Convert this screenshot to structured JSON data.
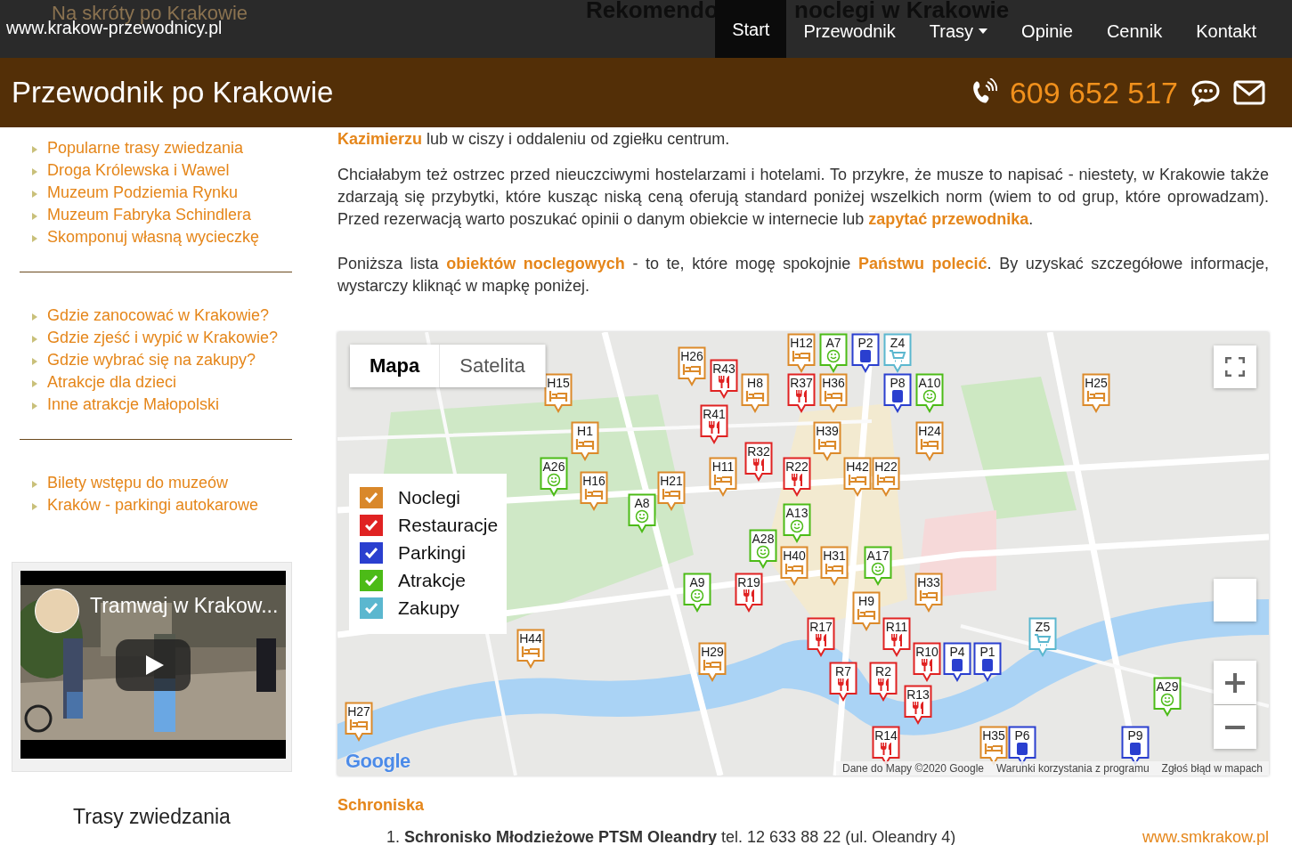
{
  "top_bar": {
    "background_texts": [
      {
        "kind": "aside",
        "text": "Na skróty po Krakowie"
      },
      {
        "kind": "heading",
        "text": "Rekomendo"
      },
      {
        "kind": "heading2",
        "text": "noclegi w Krakowie"
      }
    ],
    "site_url": "www.krakow-przewodnicy.pl",
    "nav": [
      {
        "label": "Start",
        "selected": true,
        "dropdown": false
      },
      {
        "label": "Przewodnik",
        "selected": false,
        "dropdown": false
      },
      {
        "label": "Trasy",
        "selected": false,
        "dropdown": true
      },
      {
        "label": "Opinie",
        "selected": false,
        "dropdown": false
      },
      {
        "label": "Cennik",
        "selected": false,
        "dropdown": false
      },
      {
        "label": "Kontakt",
        "selected": false,
        "dropdown": false
      }
    ]
  },
  "header": {
    "title": "Przewodnik po Krakowie",
    "phone": "609 652 517"
  },
  "sidebar": {
    "link_groups": [
      [
        "Popularne trasy zwiedzania",
        "Droga Królewska i Wawel",
        "Muzeum Podziemia Rynku",
        "Muzeum Fabryka Schindlera",
        "Skomponuj własną wycieczkę"
      ],
      [
        "Gdzie zanocować w Krakowie?",
        "Gdzie zjeść i wypić w Krakowie?",
        "Gdzie wybrać się na zakupy?",
        "Atrakcje dla dzieci",
        "Inne atrakcje Małopolski"
      ],
      [
        "Bilety wstępu do muzeów",
        "Kraków - parkingi autokarowe"
      ]
    ],
    "video": {
      "title": "Tramwaj w Krakow..."
    },
    "section_title": "Trasy zwiedzania"
  },
  "content": {
    "paragraphs": [
      "**Kazimierzu** lub w ciszy i oddaleniu od zgiełku centrum.",
      "Chciałabym też ostrzec przed nieuczciwymi hostelarzami i hotelami. To przykre, że musze to napisać - niestety, w Krakowie także zdarzają się przybytki, które kusząc niską ceną oferują standard poniżej wszelkich norm (wiem to od grup, które oprowadzam). Przed rezerwacją warto poszukać opinii o danym obiekcie w internecie lub **zapytać przewodnika**.",
      "Poniższa lista **obiektów noclegowych** - to te, które mogę spokojnie **Państwu polecić**. By uzyskać szczegółowe informacje, wystarczy kliknąć w mapkę poniżej."
    ],
    "map": {
      "tabs": [
        {
          "label": "Mapa",
          "selected": true
        },
        {
          "label": "Satelita",
          "selected": false
        }
      ],
      "legend": [
        {
          "label": "Noclegi",
          "checked": true,
          "color": "#d9882a"
        },
        {
          "label": "Restauracje",
          "checked": true,
          "color": "#e02222"
        },
        {
          "label": "Parkingi",
          "checked": true,
          "color": "#2a3fcf"
        },
        {
          "label": "Atrakcje",
          "checked": true,
          "color": "#4cbb17"
        },
        {
          "label": "Zakupy",
          "checked": true,
          "color": "#5bb7cf"
        }
      ],
      "markers": [
        {
          "label": "H12",
          "kind": "nocleg"
        },
        {
          "label": "A7",
          "kind": "atrakcja"
        },
        {
          "label": "P2",
          "kind": "parking"
        },
        {
          "label": "Z4",
          "kind": "zakupy"
        },
        {
          "label": "H26",
          "kind": "nocleg"
        },
        {
          "label": "R43",
          "kind": "restauracja"
        },
        {
          "label": "H15",
          "kind": "nocleg"
        },
        {
          "label": "H8",
          "kind": "nocleg"
        },
        {
          "label": "R37",
          "kind": "restauracja"
        },
        {
          "label": "H36",
          "kind": "nocleg"
        },
        {
          "label": "P8",
          "kind": "parking"
        },
        {
          "label": "A10",
          "kind": "atrakcja"
        },
        {
          "label": "H25",
          "kind": "nocleg"
        },
        {
          "label": "R41",
          "kind": "restauracja"
        },
        {
          "label": "H1",
          "kind": "nocleg"
        },
        {
          "label": "H39",
          "kind": "nocleg"
        },
        {
          "label": "H24",
          "kind": "nocleg"
        },
        {
          "label": "R32",
          "kind": "restauracja"
        },
        {
          "label": "A26",
          "kind": "atrakcja"
        },
        {
          "label": "H11",
          "kind": "nocleg"
        },
        {
          "label": "R22",
          "kind": "restauracja"
        },
        {
          "label": "H42",
          "kind": "nocleg"
        },
        {
          "label": "H22",
          "kind": "nocleg"
        },
        {
          "label": "H16",
          "kind": "nocleg"
        },
        {
          "label": "H21",
          "kind": "nocleg"
        },
        {
          "label": "A8",
          "kind": "atrakcja"
        },
        {
          "label": "A13",
          "kind": "atrakcja"
        },
        {
          "label": "A28",
          "kind": "atrakcja"
        },
        {
          "label": "H40",
          "kind": "nocleg"
        },
        {
          "label": "H31",
          "kind": "nocleg"
        },
        {
          "label": "A17",
          "kind": "atrakcja"
        },
        {
          "label": "A9",
          "kind": "atrakcja"
        },
        {
          "label": "R19",
          "kind": "restauracja"
        },
        {
          "label": "H33",
          "kind": "nocleg"
        },
        {
          "label": "H9",
          "kind": "nocleg"
        },
        {
          "label": "R17",
          "kind": "restauracja"
        },
        {
          "label": "R11",
          "kind": "restauracja"
        },
        {
          "label": "Z5",
          "kind": "zakupy"
        },
        {
          "label": "H44",
          "kind": "nocleg"
        },
        {
          "label": "H29",
          "kind": "nocleg"
        },
        {
          "label": "R10",
          "kind": "restauracja"
        },
        {
          "label": "P4",
          "kind": "parking"
        },
        {
          "label": "P1",
          "kind": "parking"
        },
        {
          "label": "R7",
          "kind": "restauracja"
        },
        {
          "label": "R2",
          "kind": "restauracja"
        },
        {
          "label": "A29",
          "kind": "atrakcja"
        },
        {
          "label": "R13",
          "kind": "restauracja"
        },
        {
          "label": "H27",
          "kind": "nocleg"
        },
        {
          "label": "R14",
          "kind": "restauracja"
        },
        {
          "label": "H35",
          "kind": "nocleg"
        },
        {
          "label": "P6",
          "kind": "parking"
        },
        {
          "label": "P9",
          "kind": "parking"
        }
      ],
      "logo": "Google",
      "attribution": [
        "Dane do Mapy ©2020 Google",
        "Warunki korzystania z programu",
        "Zgłoś błąd w mapach"
      ]
    },
    "section_heading": "Schroniska",
    "list": [
      {
        "number": "1.",
        "text": "**Schronisko Młodzieżowe PTSM Oleandry** tel. 12 633 88 22 (ul. Oleandry 4)",
        "link": "www.smkrakow.pl"
      }
    ]
  }
}
